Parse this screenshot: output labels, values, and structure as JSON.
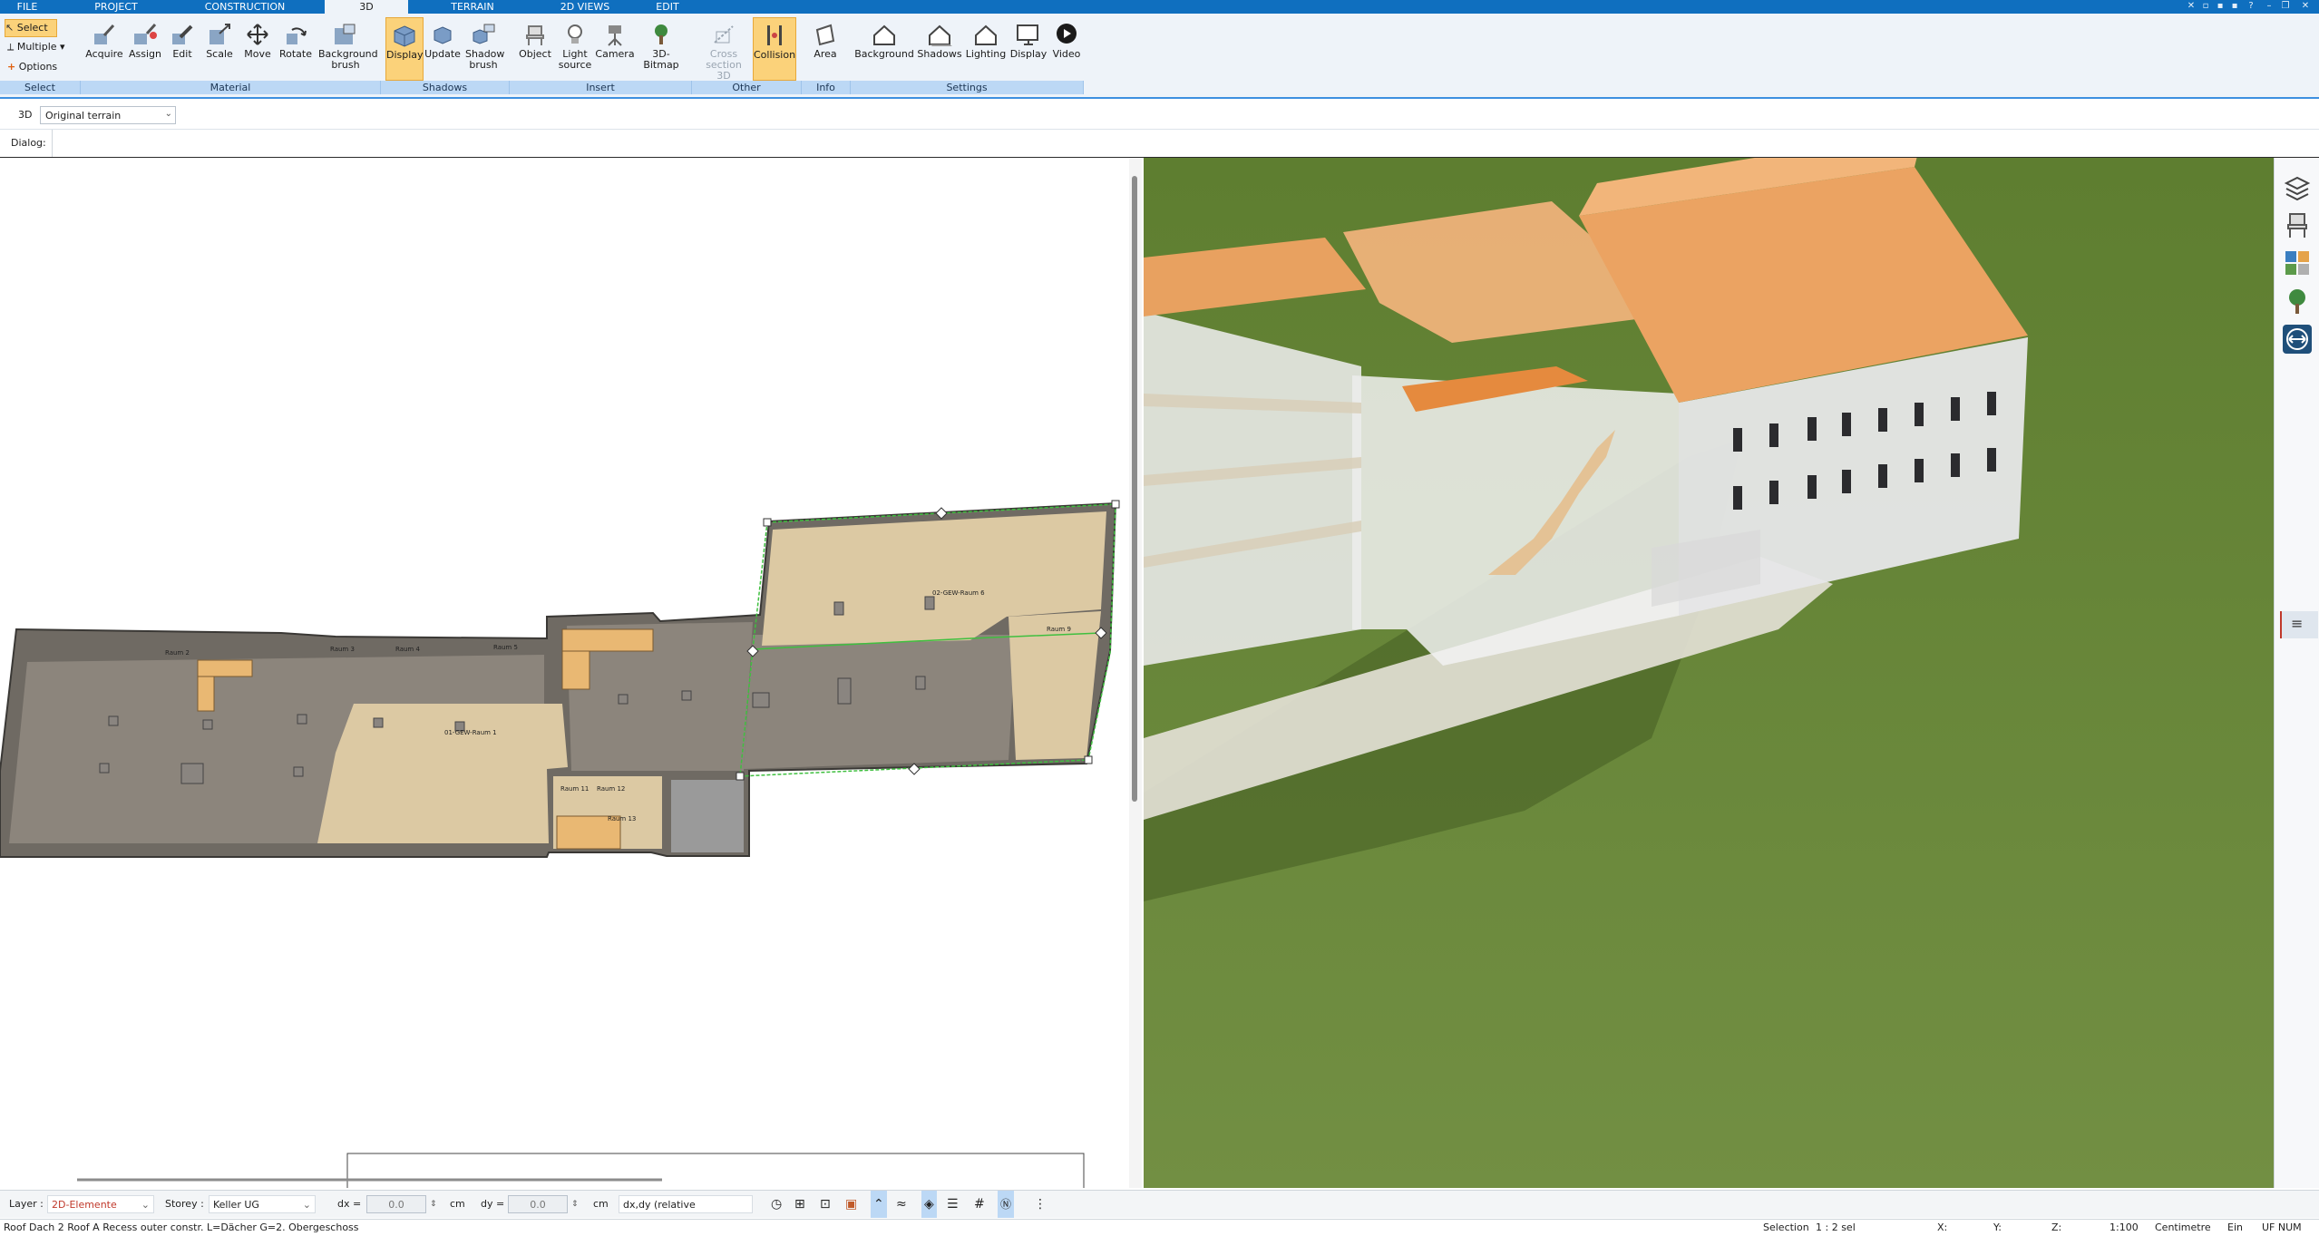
{
  "tabs": [
    "FILE",
    "PROJECT",
    "CONSTRUCTION",
    "3D",
    "TERRAIN",
    "2D VIEWS",
    "EDIT"
  ],
  "active_tab": "3D",
  "ribbon": {
    "select": {
      "select_label": "Select",
      "multiple_label": "Multiple",
      "options_label": "Options",
      "group": "Select"
    },
    "material": {
      "buttons": [
        "Acquire",
        "Assign",
        "Edit",
        "Scale",
        "Move",
        "Rotate",
        "Background brush"
      ],
      "group": "Material"
    },
    "shadows": {
      "buttons": [
        "Display",
        "Update",
        "Shadow brush"
      ],
      "group": "Shadows"
    },
    "insert": {
      "buttons": [
        "Object",
        "Light source",
        "Camera",
        "3D-Bitmap"
      ],
      "group": "Insert"
    },
    "other": {
      "buttons": [
        "Cross section 3D",
        "Collision"
      ],
      "group": "Other"
    },
    "info": {
      "buttons": [
        "Area"
      ],
      "group": "Info"
    },
    "settings": {
      "buttons": [
        "Background",
        "Shadows",
        "Lighting",
        "Display",
        "Video"
      ],
      "group": "Settings"
    }
  },
  "subbar": {
    "mode": "3D",
    "terrain_value": "Original terrain"
  },
  "dialog_label": "Dialog:",
  "plan_labels": {
    "raum1": "01-GEW-Raum 1",
    "raum2": "Raum 2",
    "raum3": "Raum 3",
    "raum4": "Raum 4",
    "raum5": "Raum 5",
    "raum6": "02-GEW-Raum 6",
    "raum9": "Raum 9",
    "raum11": "Raum 11",
    "raum12": "Raum 12",
    "raum13": "Raum 13"
  },
  "bottom": {
    "layer_label": "Layer :",
    "layer_value": "2D-Elemente",
    "storey_label": "Storey :",
    "storey_value": "Keller UG",
    "dx_label": "dx =",
    "dx_value": "0.0",
    "dy_label": "dy =",
    "dy_value": "0.0",
    "unit_cm": "cm",
    "coord_mode": "dx,dy (relative cartesian)"
  },
  "status": {
    "message": "Roof Dach 2  Roof A Recess outer constr. L=Dächer G=2. Obergeschoss",
    "selection_label": "Selection",
    "selection_value": "1 : 2 sel",
    "x_label": "X:",
    "y_label": "Y:",
    "z_label": "Z:",
    "scale": "1:100",
    "unit": "Centimetre",
    "ein": "Ein",
    "flags": "UF  NUM"
  },
  "colors": {
    "tab_bar": "#0f6fbf",
    "ribbon_bg": "#eef3f9",
    "group_label": "#bcd8f5",
    "active_button": "#fbd27a",
    "grass": "#6a8a3c",
    "roof": "#f0a050",
    "layer_text": "#c0392b"
  }
}
